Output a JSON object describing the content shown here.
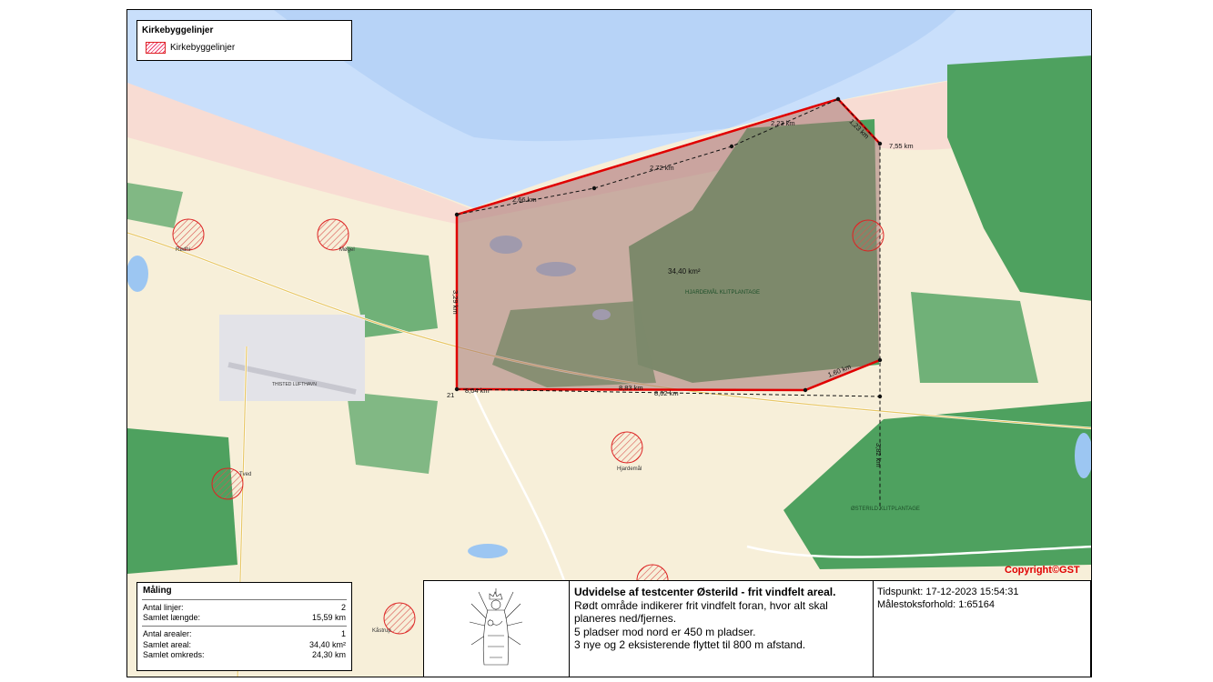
{
  "legend": {
    "title": "Kirkebyggelinjer",
    "item_label": "Kirkebyggelinjer"
  },
  "map": {
    "area_label": "34,40 km²",
    "segment_labels": [
      "2,66 km",
      "2,72 km",
      "2,23 km",
      "1,23 km",
      "7,55 km",
      "3,29 km",
      "8,83 km",
      "8,02 km",
      "1,60 km",
      "8,04 km",
      "21",
      "3,82 km"
    ],
    "place_names": [
      "Rødhi",
      "Møgel",
      "Hjardemål",
      "Tved",
      "Kåstrup",
      "THISTED LUFTHAVN",
      "HJARDEMÅL KLITPLANTAGE",
      "ØSTERILD KLITPLANTAGE"
    ],
    "colors": {
      "sea": "#c9dffb",
      "land": "#f7efd9",
      "forest": "#4ea15f",
      "area_fill": "#b48a88",
      "boundary": "#e00000"
    }
  },
  "copyright": "Copyright©GST",
  "measurement": {
    "title": "Måling",
    "rows_lines": [
      {
        "label": "Antal linjer:",
        "value": "2"
      },
      {
        "label": "Samlet længde:",
        "value": "15,59 km"
      }
    ],
    "rows_areas": [
      {
        "label": "Antal arealer:",
        "value": "1"
      },
      {
        "label": "Samlet areal:",
        "value": "34,40 km²"
      },
      {
        "label": "Samlet omkreds:",
        "value": "24,30 km"
      }
    ]
  },
  "info": {
    "title": "Udvidelse af testcenter Østerild - frit vindfelt areal.",
    "lines": [
      "Rødt område indikerer frit vindfelt foran, hvor alt skal planeres ned/fjernes.",
      "5 pladser mod nord er 450 m pladser.",
      "3 nye og 2 eksisterende flyttet til 800 m afstand."
    ],
    "timestamp": "Tidspunkt: 17-12-2023 15:54:31",
    "scale": "Målestoksforhold: 1:65164"
  }
}
